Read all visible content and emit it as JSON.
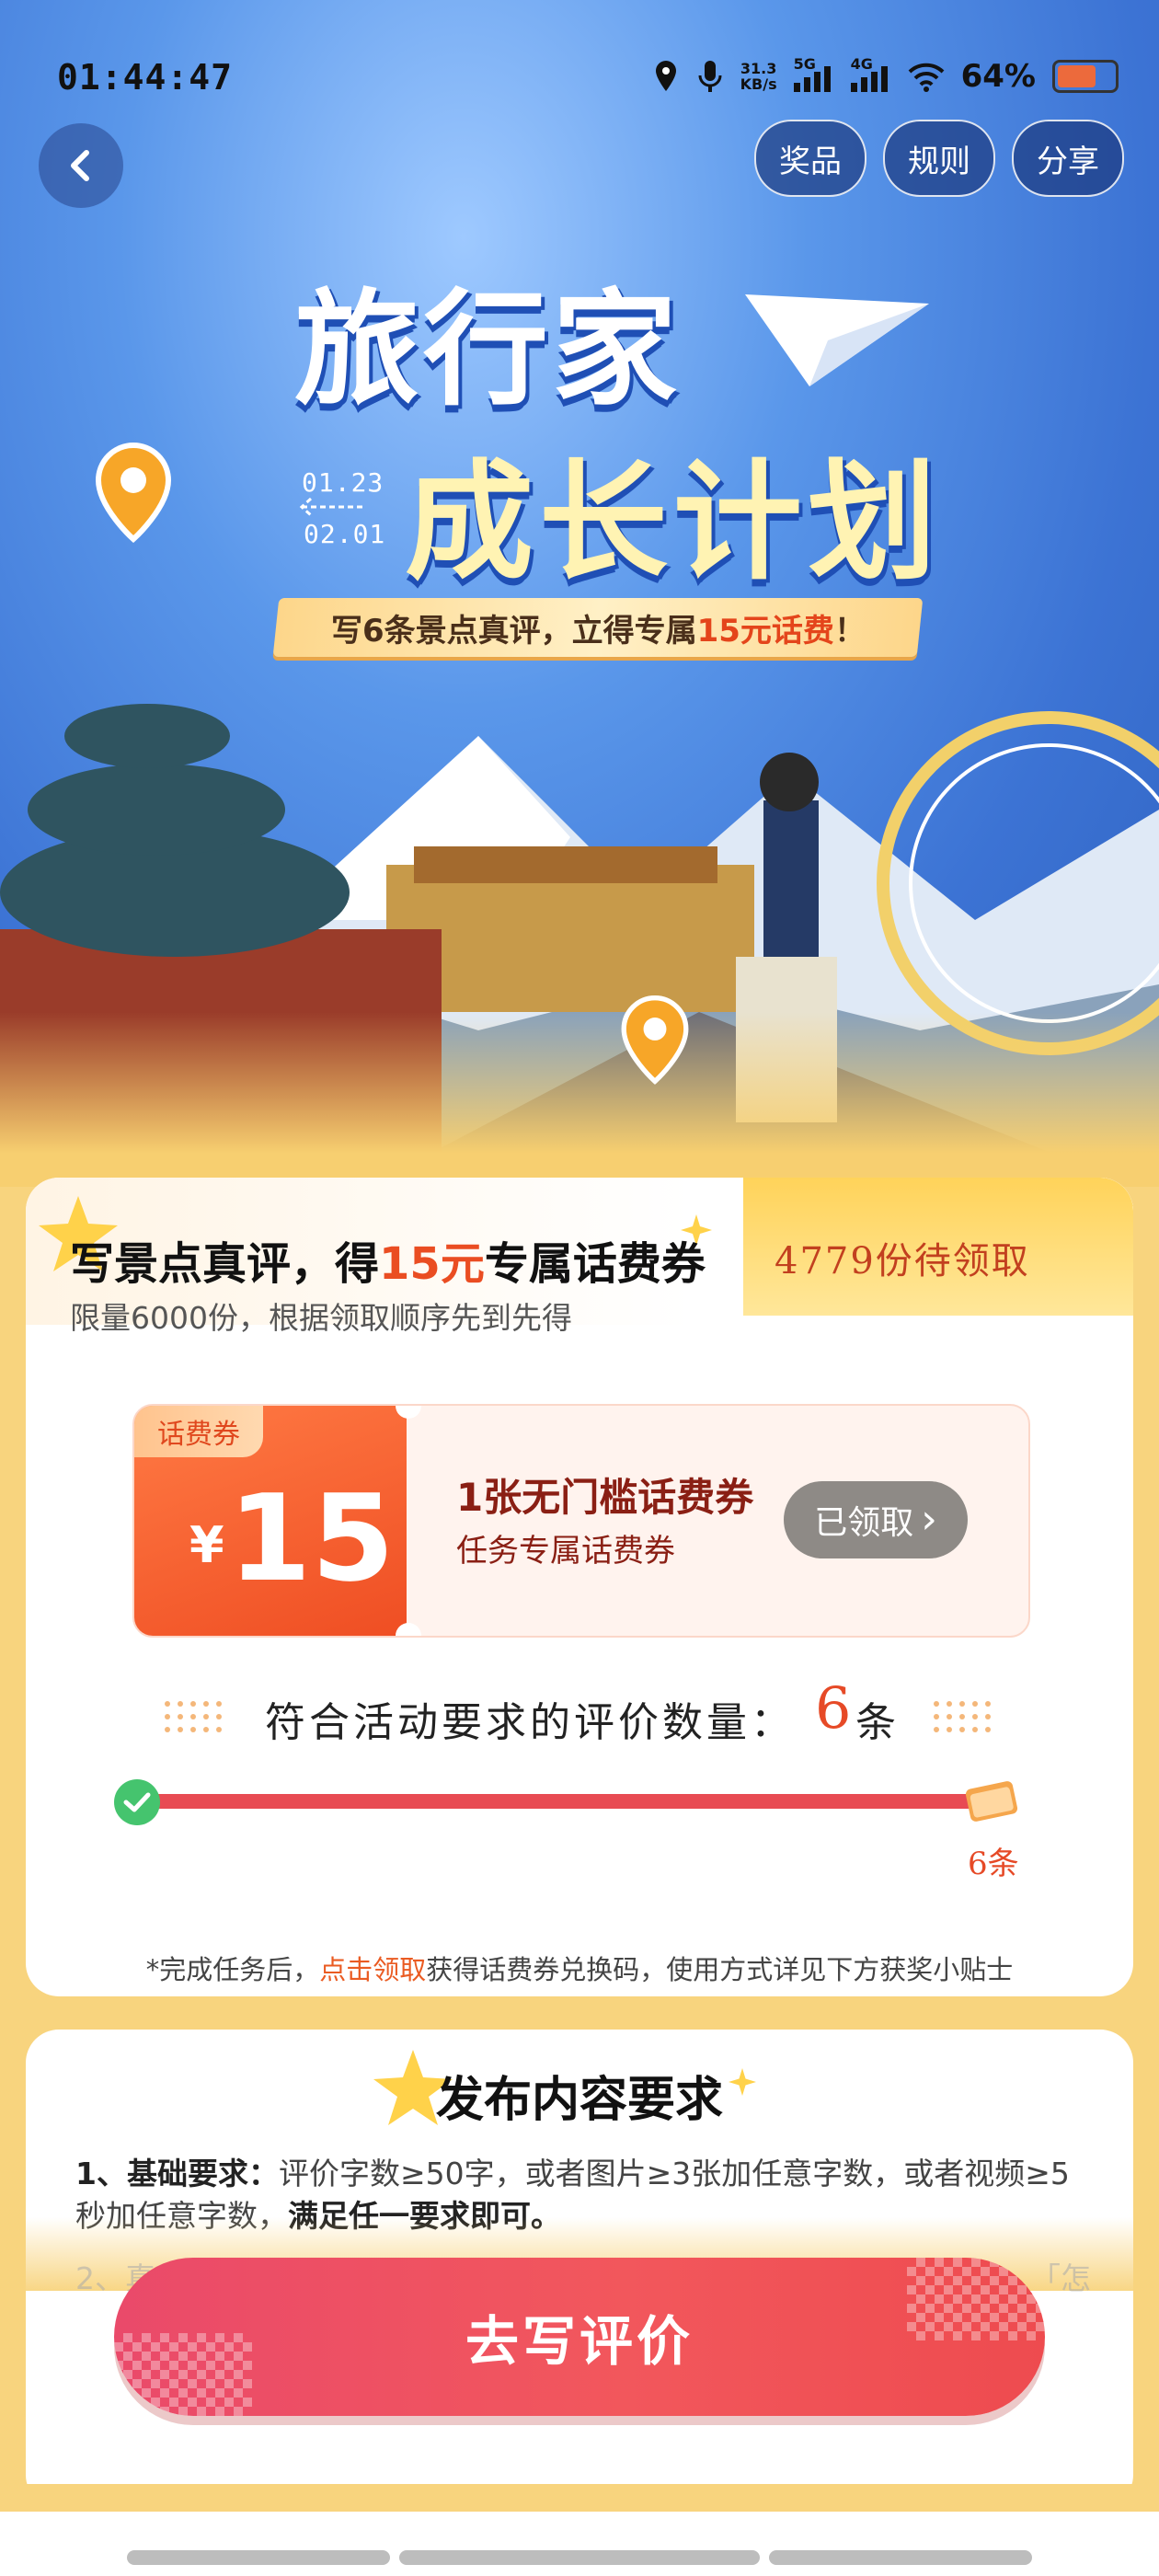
{
  "status_bar": {
    "time": "01:44:47",
    "net_speed_top": "31.3",
    "net_speed_unit": "KB/s",
    "signal1_label": "5G",
    "signal2_label": "4G",
    "battery": "64%"
  },
  "header": {
    "prize_label": "奖品",
    "rules_label": "规则",
    "share_label": "分享"
  },
  "hero": {
    "title_line1": "旅行家",
    "title_line2": "成长计划",
    "date_start": "01.23",
    "date_end": "02.01",
    "banner_prefix": "写6条景点真评，立得专属",
    "banner_highlight": "15元话费",
    "banner_suffix": "！"
  },
  "reward_card": {
    "title_prefix": "写景点真评，得",
    "title_highlight": "15元",
    "title_suffix": "专属话费券",
    "subtitle": "限量6000份，根据领取顺序先到先得",
    "remaining": "4779份待领取",
    "coupon": {
      "tag": "话费券",
      "currency": "¥",
      "amount": "15",
      "title": "1张无门槛话费券",
      "desc": "任务专属话费券",
      "button_label": "已领取",
      "button_chevron": "›"
    },
    "progress": {
      "label": "符合活动要求的评价数量：",
      "count": "6",
      "unit": "条",
      "target_label": "6条",
      "fraction": 1.0
    },
    "footnote_prefix": "*完成任务后，",
    "footnote_link": "点击领取",
    "footnote_suffix": "获得话费券兑换码，使用方式详见下方获奖小贴士"
  },
  "requirements_card": {
    "title": "发布内容要求",
    "item1_label": "1、基础要求：",
    "item1_text": "评价字数≥50字，或者图片≥3张加任意字数，或者视频≥5秒加任意字数，",
    "item1_emphasis": "满足任一要求即可。",
    "item2_partial": "2、真",
    "item2_tail": "「怎"
  },
  "cta": {
    "label": "去写评价"
  },
  "colors": {
    "accent": "#ea4d22",
    "cta": "#f2575c",
    "progress": "#e84b53",
    "page_bg": "#f8d47e"
  }
}
